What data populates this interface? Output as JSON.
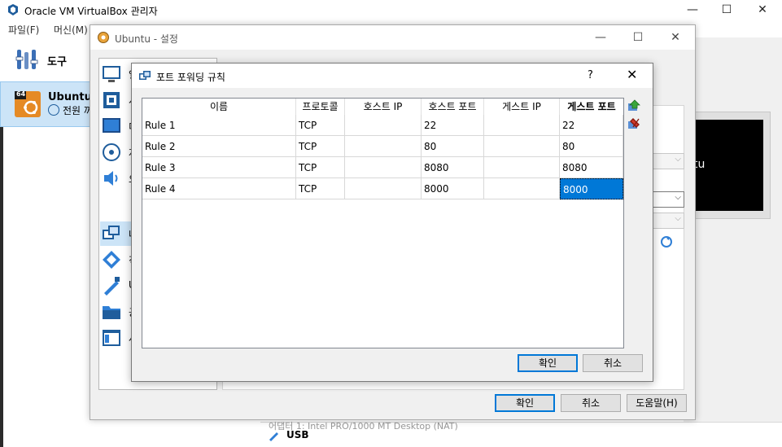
{
  "manager": {
    "title": "Oracle VM VirtualBox 관리자",
    "menu": [
      "파일(F)",
      "머신(M)"
    ],
    "tools_label": "도구",
    "vm": {
      "name": "Ubuntu",
      "state": "전원 꺼짐",
      "badge": "64"
    },
    "preview_text": "tu",
    "bottom_label": "USB",
    "bottom_faint": "어댑터 1: Intel PRO/1000 MT Desktop (NAT)"
  },
  "settings": {
    "title": "Ubuntu - 설정",
    "sidebar": [
      {
        "label": "일",
        "icon": "monitor-icon"
      },
      {
        "label": "시",
        "icon": "chip-icon"
      },
      {
        "label": "디",
        "icon": "display-icon"
      },
      {
        "label": "저",
        "icon": "disk-icon"
      },
      {
        "label": "오",
        "icon": "speaker-icon"
      },
      {
        "label": "네",
        "icon": "network-icon"
      },
      {
        "label": "직",
        "icon": "serial-port-icon"
      },
      {
        "label": "U",
        "icon": "usb-icon"
      },
      {
        "label": "공",
        "icon": "folder-icon"
      },
      {
        "label": "사",
        "icon": "ui-icon"
      }
    ],
    "buttons": {
      "ok": "확인",
      "cancel": "취소",
      "help": "도움말(H)"
    }
  },
  "dialog": {
    "title": "포트 포워딩 규칙",
    "help": "?",
    "columns": [
      "이름",
      "프로토콜",
      "호스트 IP",
      "호스트 포트",
      "게스트 IP",
      "게스트 포트"
    ],
    "rows": [
      {
        "name": "Rule 1",
        "protocol": "TCP",
        "host_ip": "",
        "host_port": "22",
        "guest_ip": "",
        "guest_port": "22"
      },
      {
        "name": "Rule 2",
        "protocol": "TCP",
        "host_ip": "",
        "host_port": "80",
        "guest_ip": "",
        "guest_port": "80"
      },
      {
        "name": "Rule 3",
        "protocol": "TCP",
        "host_ip": "",
        "host_port": "8080",
        "guest_ip": "",
        "guest_port": "8080"
      },
      {
        "name": "Rule 4",
        "protocol": "TCP",
        "host_ip": "",
        "host_port": "8000",
        "guest_ip": "",
        "guest_port": "8000"
      }
    ],
    "buttons": {
      "ok": "확인",
      "cancel": "취소"
    }
  },
  "colors": {
    "accent": "#0078d7",
    "selection": "#cce4f7",
    "add_green": "#3aa53a",
    "remove_red": "#d23a2a"
  }
}
